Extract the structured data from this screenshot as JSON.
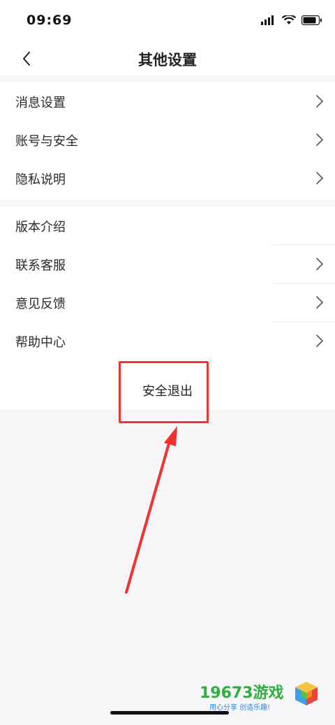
{
  "status_bar": {
    "time": "09:69"
  },
  "nav": {
    "title": "其他设置"
  },
  "group1": [
    {
      "label": "消息设置",
      "has_chevron": true
    },
    {
      "label": "账号与安全",
      "has_chevron": true
    },
    {
      "label": "隐私说明",
      "has_chevron": true
    }
  ],
  "group2": [
    {
      "label": "版本介绍",
      "has_chevron": false
    },
    {
      "label": "联系客服",
      "has_chevron": true
    },
    {
      "label": "意见反馈",
      "has_chevron": true
    },
    {
      "label": "帮助中心",
      "has_chevron": true
    }
  ],
  "logout": {
    "label": "安全退出"
  },
  "watermark": {
    "brand": "19673游戏",
    "slogan": "用心分享 创造乐趣!"
  },
  "colors": {
    "annotation_red": "#f2322c",
    "watermark_green": "#2fae3f",
    "watermark_blue": "#2f8ad6"
  }
}
